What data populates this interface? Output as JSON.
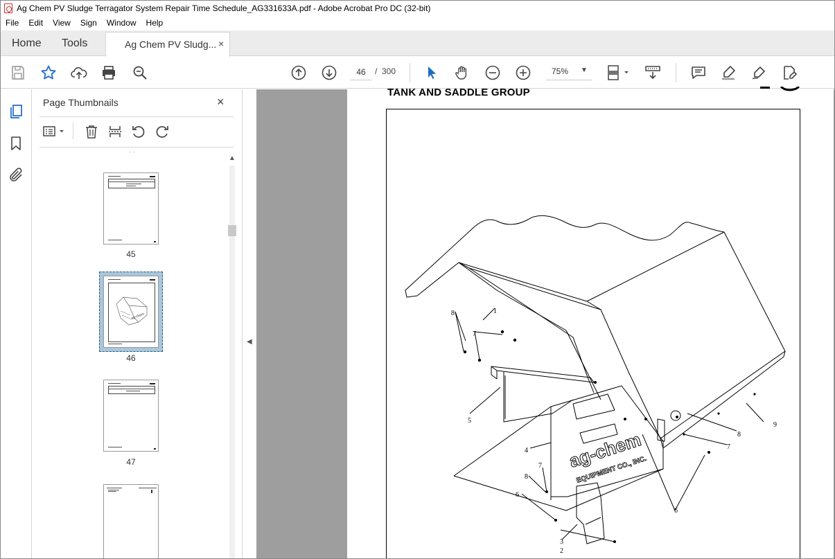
{
  "window": {
    "title": "Ag Chem PV Sludge Terragator System Repair Time Schedule_AG331633A.pdf - Adobe Acrobat Pro DC (32-bit)"
  },
  "menu": {
    "items": [
      "File",
      "Edit",
      "View",
      "Sign",
      "Window",
      "Help"
    ]
  },
  "tabs": {
    "home": "Home",
    "tools": "Tools",
    "document": "Ag Chem PV Sludg...",
    "close": "×"
  },
  "toolbar": {
    "current_page": "46",
    "separator": "/",
    "total_pages": "300",
    "zoom": "75%"
  },
  "thumbnails_panel": {
    "title": "Page Thumbnails",
    "close": "×",
    "pages": [
      {
        "label": "45"
      },
      {
        "label": "46",
        "selected": true
      },
      {
        "label": "47"
      },
      {
        "label": ""
      }
    ]
  },
  "document": {
    "heading": "TANK AND SADDLE GROUP",
    "callouts": [
      "1",
      "2",
      "3",
      "4",
      "5",
      "6",
      "6",
      "7",
      "7",
      "7",
      "8",
      "8",
      "8",
      "9"
    ],
    "logo_text": "ag-chem EQUIPMENT CO., INC."
  },
  "colors": {
    "acrobat_red": "#d7282f",
    "accent_blue": "#1f6bc4",
    "selected_thumb": "#a9c6da",
    "canvas_gray": "#9e9e9e"
  }
}
